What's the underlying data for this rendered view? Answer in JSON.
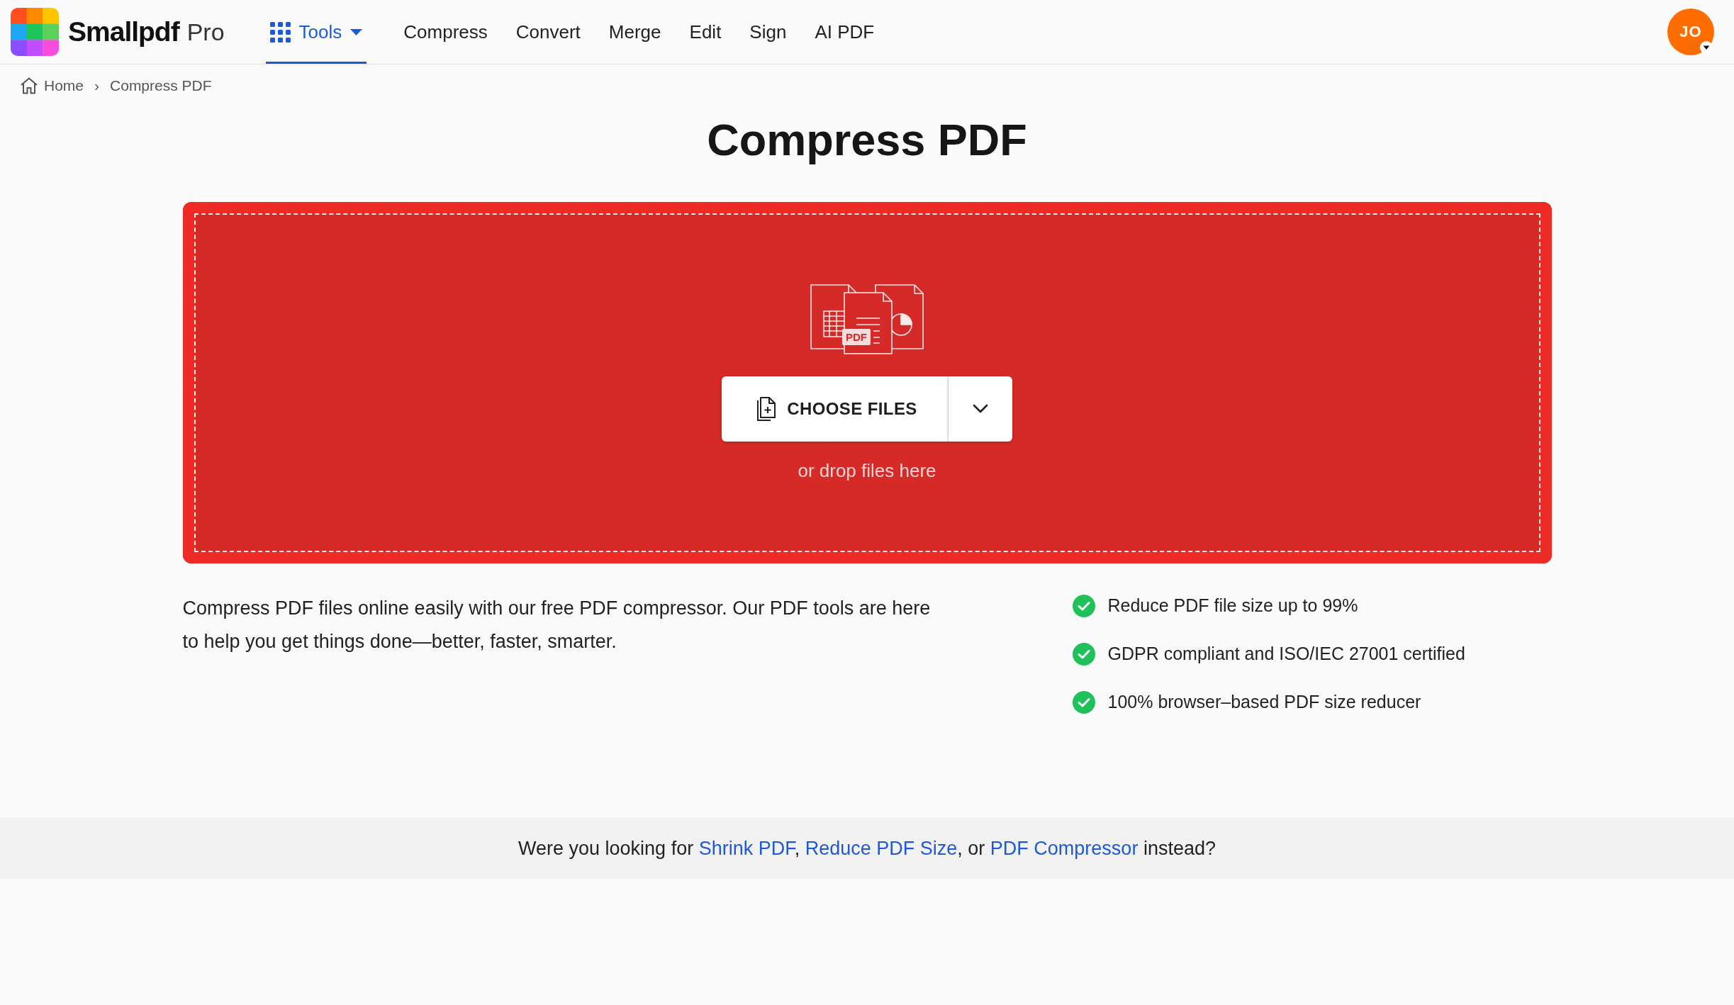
{
  "header": {
    "logo": {
      "name": "Smallpdf",
      "plan": "Pro"
    },
    "nav": [
      {
        "label": "Tools",
        "kind": "menu",
        "selected": true
      },
      {
        "label": "Compress",
        "kind": "link",
        "selected": false
      },
      {
        "label": "Convert",
        "kind": "link",
        "selected": false
      },
      {
        "label": "Merge",
        "kind": "link",
        "selected": false
      },
      {
        "label": "Edit",
        "kind": "link",
        "selected": false
      },
      {
        "label": "Sign",
        "kind": "link",
        "selected": false
      },
      {
        "label": "AI PDF",
        "kind": "link",
        "selected": false
      }
    ],
    "avatar": {
      "initials": "JO"
    }
  },
  "breadcrumb": {
    "separator": "›",
    "items": [
      {
        "label": "Home",
        "kind": "home"
      },
      {
        "label": "Compress PDF",
        "kind": "current"
      }
    ]
  },
  "title": "Compress PDF",
  "dropzone": {
    "illustration_label": "PDF",
    "button": "CHOOSE FILES",
    "hint": "or drop files here"
  },
  "description": "Compress PDF files online easily with our free PDF compressor. Our PDF tools are here to help you get things done—better, faster, smarter.",
  "features": [
    "Reduce PDF file size up to 99%",
    "GDPR compliant and ISO/IEC 27001 certified",
    "100% browser–based PDF size reducer"
  ],
  "suggestion": [
    {
      "kind": "text",
      "text": "Were you looking for "
    },
    {
      "kind": "link",
      "text": "Shrink PDF"
    },
    {
      "kind": "text",
      "text": ", "
    },
    {
      "kind": "link",
      "text": "Reduce PDF Size"
    },
    {
      "kind": "text",
      "text": ", or "
    },
    {
      "kind": "link",
      "text": "PDF Compressor"
    },
    {
      "kind": "text",
      "text": " instead?"
    }
  ]
}
